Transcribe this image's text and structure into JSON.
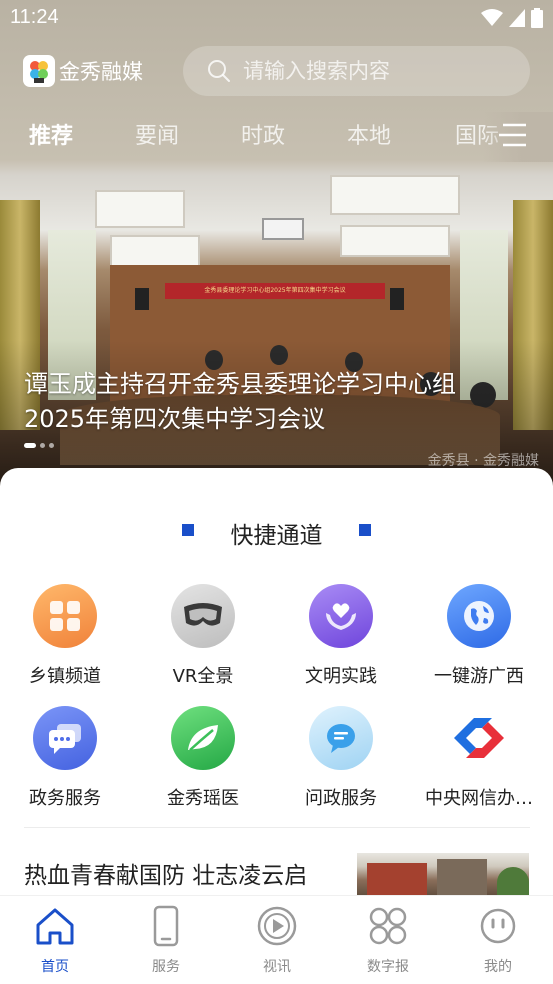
{
  "status_bar": {
    "time": "11:24"
  },
  "header": {
    "logo_text": "金秀融媒",
    "search_placeholder": "请输入搜索内容"
  },
  "tabs": [
    {
      "label": "推荐",
      "active": true
    },
    {
      "label": "要闻",
      "active": false
    },
    {
      "label": "时政",
      "active": false
    },
    {
      "label": "本地",
      "active": false
    },
    {
      "label": "国际",
      "active": false
    }
  ],
  "hero": {
    "banner_text": "金秀县委理论学习中心组2025年第四次集中学习会议",
    "headline_line1": "谭玉成主持召开金秀县委理论学习中心组",
    "headline_line2": "2025年第四次集中学习会议",
    "watermark": "金秀县 · 金秀融媒",
    "slide_count": 3,
    "active_slide": 1
  },
  "quick": {
    "title": "快捷通道",
    "items": [
      {
        "label": "乡镇频道",
        "icon": "grid-apps-icon",
        "color": "#f59a4d"
      },
      {
        "label": "VR全景",
        "icon": "vr-headset-icon",
        "color": "#c9c9c9"
      },
      {
        "label": "文明实践",
        "icon": "hands-heart-icon",
        "color": "#8a63e8"
      },
      {
        "label": "一键游广西",
        "icon": "globe-icon",
        "color": "#3f7cf0"
      },
      {
        "label": "政务服务",
        "icon": "chat-bubbles-icon",
        "color": "#4f6ee8"
      },
      {
        "label": "金秀瑶医",
        "icon": "leaf-icon",
        "color": "#3cc05a"
      },
      {
        "label": "问政服务",
        "icon": "message-icon",
        "color": "#7cc3ee"
      },
      {
        "label": "中央网信办…",
        "icon": "cac-logo-icon",
        "color": "#e8303a"
      }
    ]
  },
  "news": {
    "title": "热血青春献国防 壮志凌云启"
  },
  "bottom_nav": [
    {
      "label": "首页",
      "icon": "home-icon",
      "active": true
    },
    {
      "label": "服务",
      "icon": "phone-icon",
      "active": false
    },
    {
      "label": "视讯",
      "icon": "play-icon",
      "active": false
    },
    {
      "label": "数字报",
      "icon": "clover-icon",
      "active": false
    },
    {
      "label": "我的",
      "icon": "smile-icon",
      "active": false
    }
  ],
  "colors": {
    "accent": "#1a4fc9",
    "inactive": "#8a8a8a"
  }
}
